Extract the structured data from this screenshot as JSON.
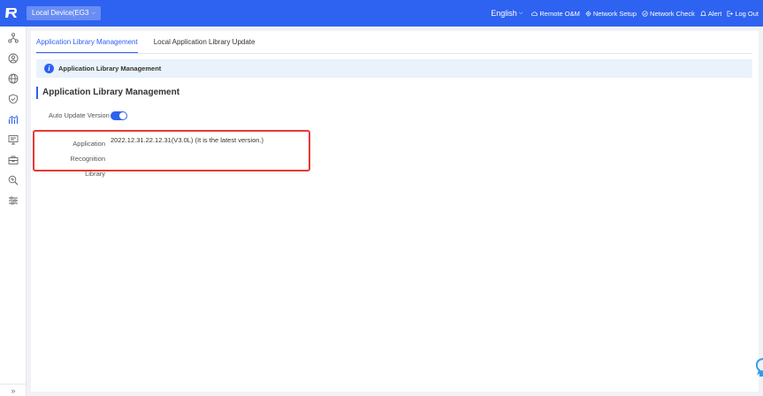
{
  "header": {
    "device_select": "Local Device(EG3",
    "language": "English",
    "nav": [
      {
        "label": "Remote O&M",
        "icon": "cloud-icon"
      },
      {
        "label": "Network Setup",
        "icon": "network-setup-icon"
      },
      {
        "label": "Network Check",
        "icon": "network-check-icon"
      },
      {
        "label": "Alert",
        "icon": "alert-icon"
      },
      {
        "label": "Log Out",
        "icon": "logout-icon"
      }
    ],
    "colors": {
      "bar": "#2e62f0"
    }
  },
  "sidebar": {
    "icons": [
      "topology-icon",
      "user-icon",
      "globe-icon",
      "shield-icon",
      "chart-icon",
      "monitor-icon",
      "toolbox-icon",
      "search-diagnose-icon",
      "settings-sliders-icon"
    ],
    "collapse_label": "»"
  },
  "main": {
    "tabs": [
      {
        "label": "Application Library Management",
        "active": true
      },
      {
        "label": "Local Application Library Update",
        "active": false
      }
    ],
    "info_text": "Application Library Management",
    "section_title": "Application Library Management",
    "auto_update": {
      "label": "Auto Update Version",
      "enabled": true
    },
    "recognition": {
      "label_line1": "Application Recognition",
      "label_line2": "Library",
      "value": "2022.12.31.22.12.31(V3.0L) (It is the latest version.)"
    },
    "highlight_color": "#e53935"
  }
}
